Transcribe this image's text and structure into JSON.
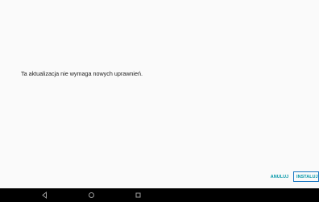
{
  "dialog": {
    "message": "Ta aktualizacja nie wymaga nowych uprawnień."
  },
  "actions": {
    "cancel_label": "ANULUJ",
    "install_label": "INSTALUJ"
  },
  "navbar": {
    "icons": [
      "back-icon",
      "home-icon",
      "recents-icon"
    ]
  },
  "colors": {
    "background": "#fafafa",
    "text": "#212121",
    "accent": "#0096a7",
    "focus_border": "#1a78c2",
    "navbar": "#000000"
  }
}
